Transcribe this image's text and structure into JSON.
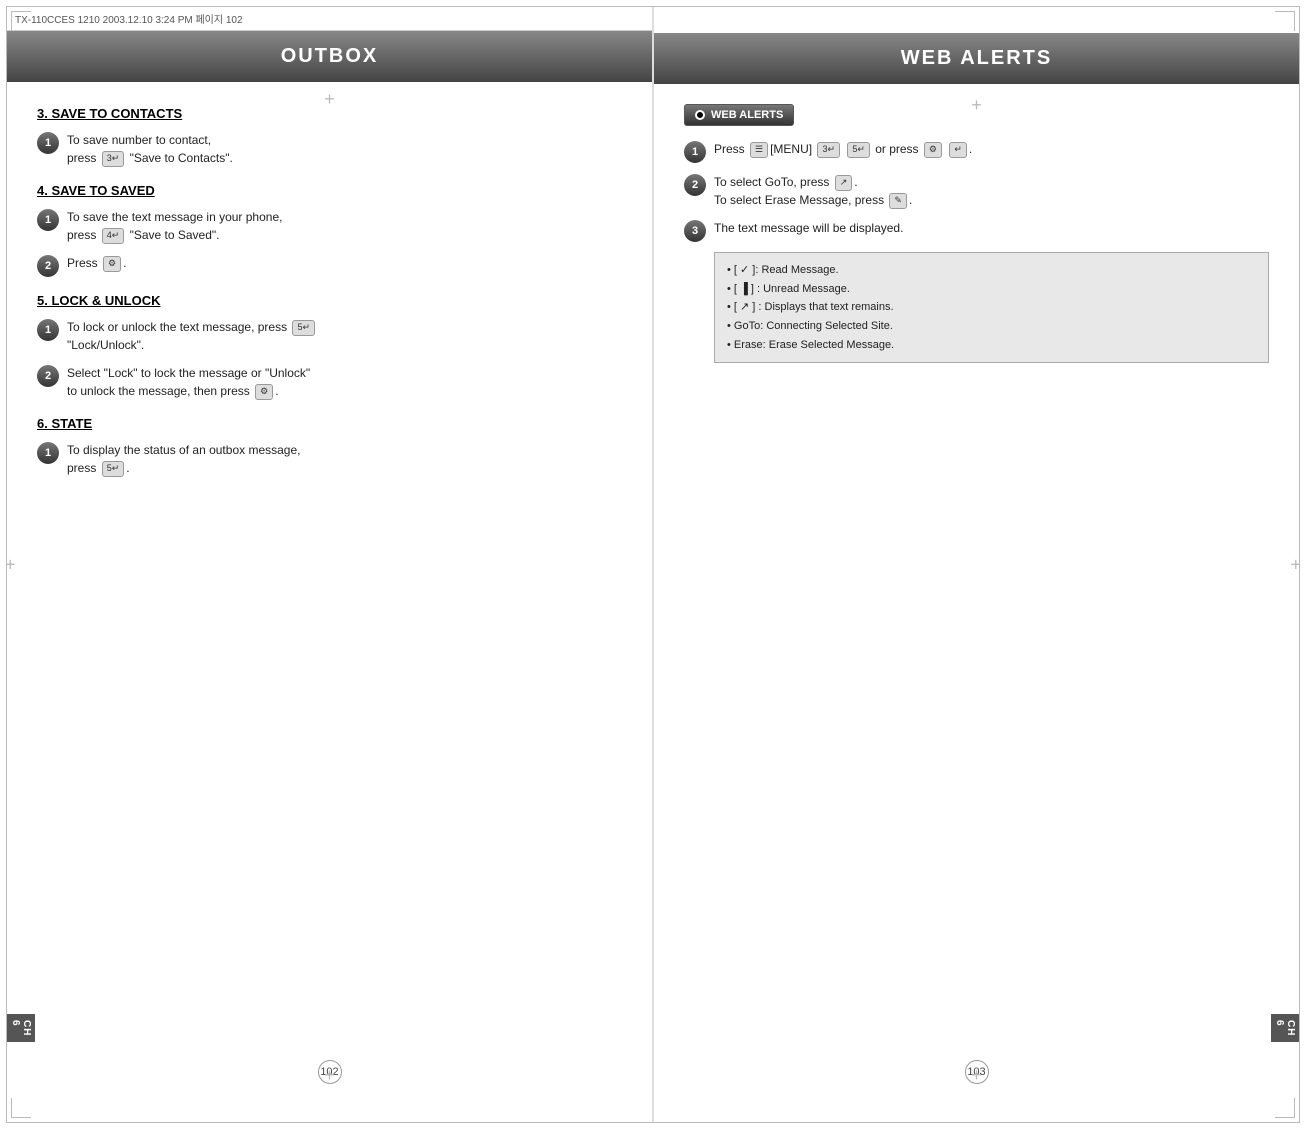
{
  "topbar": {
    "label": "TX-110CCES 1210  2003.12.10 3:24 PM  페이지 102"
  },
  "left_page": {
    "header": "OUTBOX",
    "sections": [
      {
        "id": "save-to-contacts",
        "title": "3. SAVE TO CONTACTS",
        "steps": [
          {
            "num": "1",
            "text": "To save number to contact, press",
            "text2": "\"Save to Contacts\".",
            "btn": "3/5"
          }
        ]
      },
      {
        "id": "save-to-saved",
        "title": "4. SAVE TO SAVED",
        "steps": [
          {
            "num": "1",
            "text": "To save the text message in your phone, press",
            "text2": "\"Save to Saved\".",
            "btn": "4/5"
          },
          {
            "num": "2",
            "text": "Press",
            "btn": "OK"
          }
        ]
      },
      {
        "id": "lock-unlock",
        "title": "5. LOCK & UNLOCK",
        "steps": [
          {
            "num": "1",
            "text": "To lock or unlock the text message, press",
            "text2": "\"Lock/Unlock\".",
            "btn": "5/5"
          },
          {
            "num": "2",
            "text": "Select \"Lock\" to lock the message or \"Unlock\" to unlock the message, then press",
            "btn": "OK"
          }
        ]
      },
      {
        "id": "state",
        "title": "6. STATE",
        "steps": [
          {
            "num": "1",
            "text": "To display the status of an outbox message, press",
            "btn": "5/5"
          }
        ]
      }
    ],
    "page_number": "102",
    "chapter": "CH\n6"
  },
  "right_page": {
    "header": "WEB ALERTS",
    "badge_label": "WEB ALERTS",
    "sections": [
      {
        "id": "web-alerts-steps",
        "steps": [
          {
            "num": "1",
            "text": "Press",
            "text2": "[MENU]",
            "text3": "or press",
            "btn1": "MENU",
            "btn2": "3/5",
            "btn3": "OK"
          },
          {
            "num": "2",
            "text": "To select GoTo, press",
            "text2": ".",
            "text3": "To select Erase Message, press",
            "btn1": "GoTo",
            "btn2": "Erase"
          },
          {
            "num": "3",
            "text": "The text message will be displayed."
          }
        ]
      }
    ],
    "info_box": [
      "[ ✓ ]: Read Message.",
      "[ ▐ ] : Unread Message.",
      "[ ↗ ] : Displays that text remains.",
      "GoTo: Connecting Selected Site.",
      "Erase: Erase Selected Message."
    ],
    "page_number": "103",
    "chapter": "CH\n6"
  }
}
